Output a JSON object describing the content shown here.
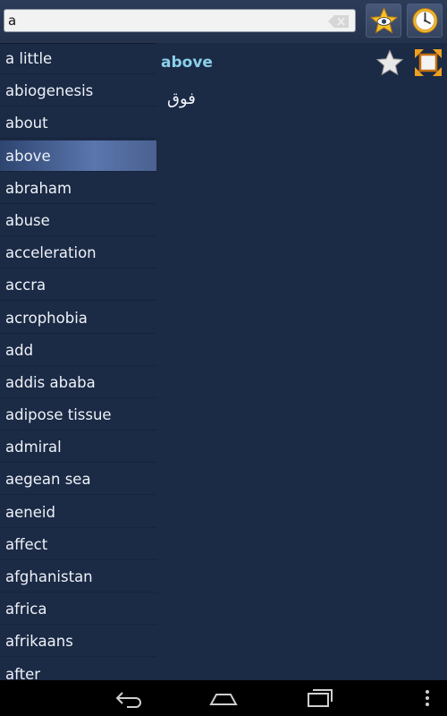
{
  "search": {
    "value": "a",
    "placeholder": ""
  },
  "toolbar": {
    "favorites_icon": "star-eye-icon",
    "history_icon": "clock-icon"
  },
  "list": {
    "selected_index": 3,
    "items": [
      "a little",
      "abiogenesis",
      "about",
      "above",
      "abraham",
      "abuse",
      "acceleration",
      "accra",
      "acrophobia",
      "add",
      "addis ababa",
      "adipose tissue",
      "admiral",
      "aegean sea",
      "aeneid",
      "affect",
      "afghanistan",
      "africa",
      "afrikaans",
      "after"
    ]
  },
  "detail": {
    "word": "above",
    "translation": "فوق"
  },
  "colors": {
    "background": "#1b2a45",
    "accent_word": "#8ad0ea",
    "selected_row": "#4a6190",
    "star": "#f4b400"
  }
}
